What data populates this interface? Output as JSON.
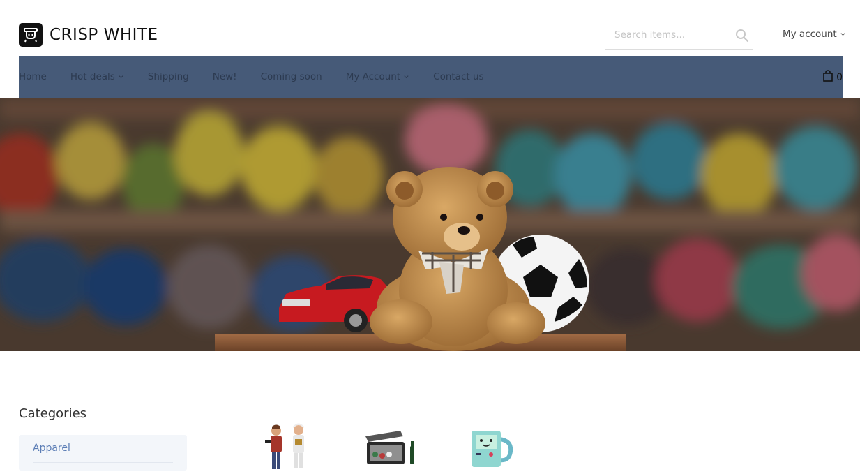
{
  "brand": {
    "name": "CRISP WHITE",
    "logo_icon": "robot-logo-icon"
  },
  "search": {
    "placeholder": "Search items...",
    "icon": "search-icon"
  },
  "account": {
    "label": "My account",
    "icon": "chevron-down-icon"
  },
  "nav": {
    "items": [
      {
        "label": "Home",
        "has_dropdown": false
      },
      {
        "label": "Hot deals",
        "has_dropdown": true
      },
      {
        "label": "Shipping",
        "has_dropdown": false
      },
      {
        "label": "New!",
        "has_dropdown": false
      },
      {
        "label": "Coming soon",
        "has_dropdown": false
      },
      {
        "label": "My Account",
        "has_dropdown": true
      },
      {
        "label": "Contact us",
        "has_dropdown": false
      }
    ],
    "cart": {
      "icon": "shopping-bag-icon",
      "count": "0"
    },
    "background": "#465a78"
  },
  "hero": {
    "image": "toys-hero-banner"
  },
  "sidebar": {
    "title": "Categories",
    "items": [
      {
        "label": "Apparel"
      }
    ]
  },
  "products": [
    {
      "image": "figurines-product-image"
    },
    {
      "image": "poker-case-product-image"
    },
    {
      "image": "robot-mug-product-image"
    }
  ],
  "colors": {
    "accent": "#5b7db5",
    "nav_bg": "#465a78",
    "nav_text": "#2c3a50"
  }
}
